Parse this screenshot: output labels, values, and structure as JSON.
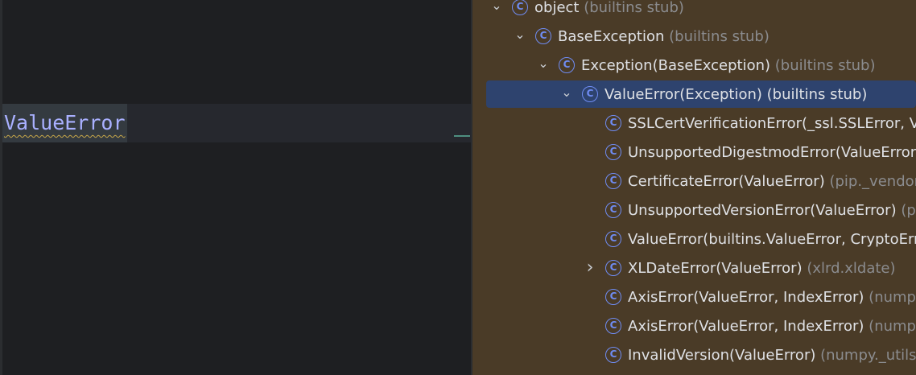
{
  "editor": {
    "code_token": "ValueError"
  },
  "hierarchy": {
    "class_icon_glyph": "C",
    "icon_name": "class-icon",
    "expanded_glyph": "⌄",
    "collapsed_glyph": "›",
    "rows": [
      {
        "name": "object",
        "hint": " (builtins stub)",
        "depth": 0,
        "arrow": "expanded"
      },
      {
        "name": "BaseException",
        "hint": " (builtins stub)",
        "depth": 1,
        "arrow": "expanded"
      },
      {
        "name": "Exception(BaseException)",
        "hint": " (builtins stub)",
        "depth": 2,
        "arrow": "expanded"
      },
      {
        "name": "ValueError(Exception) (builtins stub)",
        "hint": "",
        "depth": 3,
        "arrow": "expanded",
        "selected": true
      },
      {
        "name": "SSLCertVerificationError(_ssl.SSLError, Val",
        "hint": "",
        "depth": 4
      },
      {
        "name": "UnsupportedDigestmodError(ValueError)",
        "hint": "",
        "depth": 4
      },
      {
        "name": "CertificateError(ValueError)",
        "hint": " (pip._vendor.d",
        "depth": 4
      },
      {
        "name": "UnsupportedVersionError(ValueError)",
        "hint": " (pip",
        "depth": 4
      },
      {
        "name": "ValueError(builtins.ValueError, CryptoError",
        "hint": "",
        "depth": 4
      },
      {
        "name": "XLDateError(ValueError)",
        "hint": " (xlrd.xldate)",
        "depth": 4,
        "arrow": "collapsed"
      },
      {
        "name": "AxisError(ValueError, IndexError)",
        "hint": " (numpy.e",
        "depth": 4
      },
      {
        "name": "AxisError(ValueError, IndexError)",
        "hint": " (numpy.e",
        "depth": 4
      },
      {
        "name": "InvalidVersion(ValueError)",
        "hint": " (numpy._utils._p",
        "depth": 4
      }
    ]
  },
  "colors": {
    "editor_bg": "#1e1f22",
    "tree_bg": "#4a3b27",
    "selection": "#2e436e",
    "class_icon": "#6f8cf3",
    "hint_text": "#8b8c8f"
  }
}
